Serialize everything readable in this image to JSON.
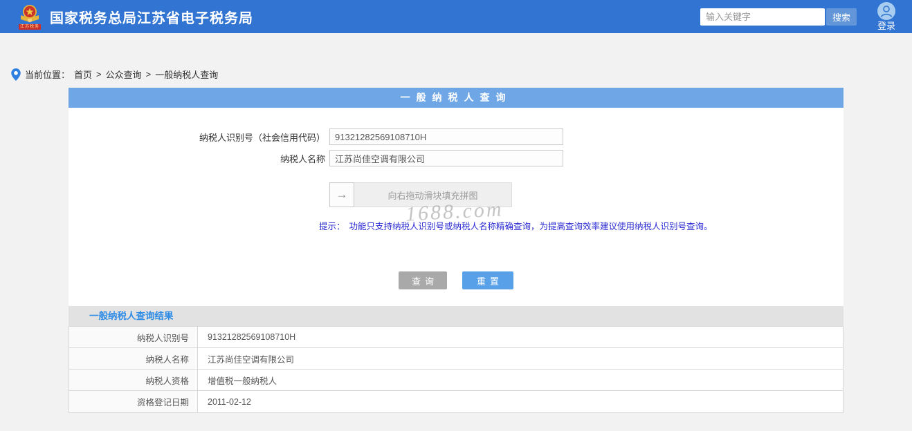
{
  "header": {
    "title": "国家税务总局江苏省电子税务局",
    "logo_badge": "江苏税务",
    "search": {
      "placeholder": "输入关键字",
      "button_label": "搜索"
    },
    "login_label": "登录"
  },
  "breadcrumb": {
    "prefix": "当前位置：",
    "items": [
      "首页",
      "公众查询",
      "一般纳税人查询"
    ],
    "separator": ">"
  },
  "form": {
    "title": "一般纳税人查询",
    "fields": [
      {
        "label": "纳税人识别号（社会信用代码）",
        "value": "91321282569108710H"
      },
      {
        "label": "纳税人名称",
        "value": "江苏尚佳空调有限公司"
      }
    ],
    "slider": {
      "arrow": "→",
      "text": "向右拖动滑块填充拼图"
    },
    "hint_prefix": "提示：",
    "hint_text": "功能只支持纳税人识别号或纳税人名称精确查询，为提高查询效率建议使用纳税人识别号查询。",
    "buttons": {
      "query": "查询",
      "reset": "重置"
    }
  },
  "results": {
    "title": "一般纳税人查询结果",
    "rows": [
      {
        "label": "纳税人识别号",
        "value": "91321282569108710H"
      },
      {
        "label": "纳税人名称",
        "value": "江苏尚佳空调有限公司"
      },
      {
        "label": "纳税人资格",
        "value": "增值税一般纳税人"
      },
      {
        "label": "资格登记日期",
        "value": "2011-02-12"
      }
    ]
  },
  "watermark": "1688.com",
  "colors": {
    "header_bg": "#3274d2",
    "panel_title_bg": "#6fa7e6",
    "reset_button_bg": "#58a0e8",
    "query_button_bg": "#a9a9a9",
    "results_title_color": "#2e8ce6",
    "hint_color": "#2b2bd2"
  }
}
